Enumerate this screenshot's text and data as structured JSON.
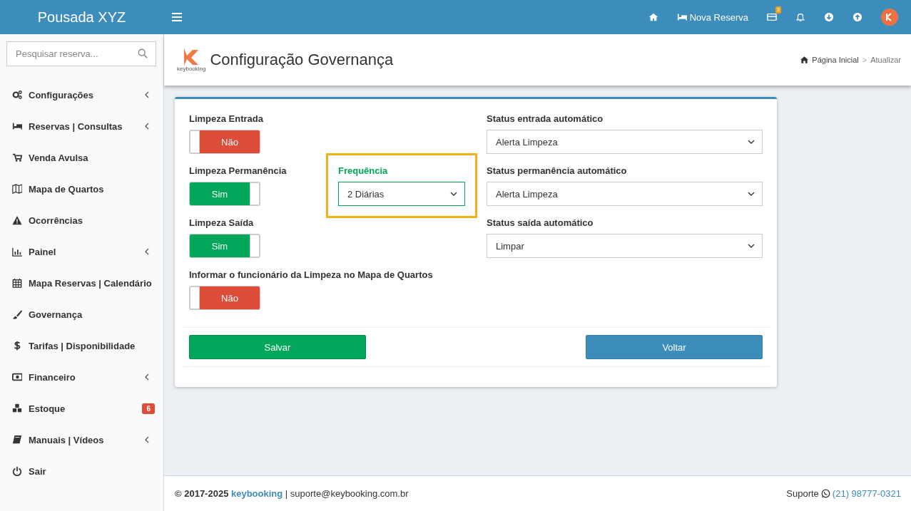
{
  "header": {
    "brand": "Pousada XYZ",
    "new_booking": "Nova Reserva",
    "card_badge": "3"
  },
  "sidebar": {
    "search": {
      "placeholder": "Pesquisar reserva..."
    },
    "items": [
      {
        "label": "Configurações",
        "submenu": true
      },
      {
        "label": "Reservas | Consultas",
        "submenu": true
      },
      {
        "label": "Venda Avulsa",
        "submenu": false
      },
      {
        "label": "Mapa de Quartos",
        "submenu": false
      },
      {
        "label": "Ocorrências",
        "submenu": false
      },
      {
        "label": "Painel",
        "submenu": true
      },
      {
        "label": "Mapa Reservas | Calendário",
        "submenu": false
      },
      {
        "label": "Governança",
        "submenu": false
      },
      {
        "label": "Tarifas | Disponibilidade",
        "submenu": false
      },
      {
        "label": "Financeiro",
        "submenu": true
      },
      {
        "label": "Estoque",
        "submenu": false,
        "badge": "6"
      },
      {
        "label": "Manuais | Vídeos",
        "submenu": true
      },
      {
        "label": "Sair",
        "submenu": false
      }
    ]
  },
  "page_header": {
    "logo_text": "keybooking",
    "title": "Configuração Governança",
    "breadcrumb": {
      "home": "Página Inicial",
      "separator": ">",
      "current": "Atualizar"
    }
  },
  "form": {
    "toggles": [
      {
        "label": "Limpeza Entrada",
        "on": false,
        "text": "Não"
      },
      {
        "label": "Limpeza Permanência",
        "on": true,
        "text": "Sim"
      },
      {
        "label": "Limpeza Saída",
        "on": true,
        "text": "Sim"
      },
      {
        "label": "Informar o funcionário da Limpeza no Mapa de Quartos",
        "on": false,
        "text": "Não"
      }
    ],
    "frequency": {
      "label": "Frequência",
      "value": "2 Diárias",
      "highlighted": true
    },
    "status_selects": [
      {
        "label": "Status entrada automático",
        "value": "Alerta Limpeza"
      },
      {
        "label": "Status permanência automático",
        "value": "Alerta Limpeza"
      },
      {
        "label": "Status saída automático",
        "value": "Limpar"
      }
    ],
    "buttons": {
      "save": "Salvar",
      "back": "Voltar"
    }
  },
  "footer": {
    "copyright": "© 2017-2025",
    "brand_link": "keybooking",
    "email": "| suporte@keybooking.com.br",
    "support_label": "Suporte",
    "phone": "(21) 98777-0321"
  }
}
